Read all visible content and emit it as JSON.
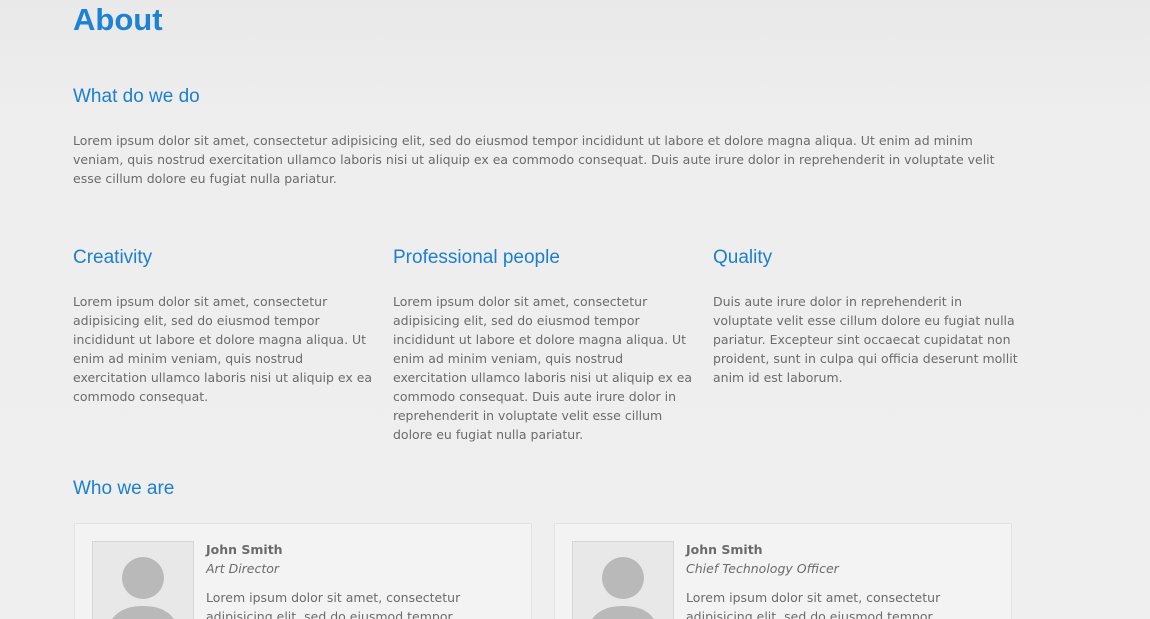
{
  "page": {
    "title": "About"
  },
  "what_we_do": {
    "heading": "What do we do",
    "text": "Lorem ipsum dolor sit amet, consectetur adipisicing elit, sed do eiusmod tempor incididunt ut labore et dolore magna aliqua. Ut enim ad minim veniam, quis nostrud exercitation ullamco laboris nisi ut aliquip ex ea commodo consequat. Duis aute irure dolor in reprehenderit in voluptate velit esse cillum dolore eu fugiat nulla pariatur."
  },
  "features": [
    {
      "heading": "Creativity",
      "text": "Lorem ipsum dolor sit amet, consectetur adipisicing elit, sed do eiusmod tempor incididunt ut labore et dolore magna aliqua. Ut enim ad minim veniam, quis nostrud exercitation ullamco laboris nisi ut aliquip ex ea commodo consequat."
    },
    {
      "heading": "Professional people",
      "text": "Lorem ipsum dolor sit amet, consectetur adipisicing elit, sed do eiusmod tempor incididunt ut labore et dolore magna aliqua. Ut enim ad minim veniam, quis nostrud exercitation ullamco laboris nisi ut aliquip ex ea commodo consequat. Duis aute irure dolor in reprehenderit in voluptate velit esse cillum dolore eu fugiat nulla pariatur."
    },
    {
      "heading": "Quality",
      "text": "Duis aute irure dolor in reprehenderit in voluptate velit esse cillum dolore eu fugiat nulla pariatur. Excepteur sint occaecat cupidatat non proident, sunt in culpa qui officia deserunt mollit anim id est laborum."
    }
  ],
  "who_we_are": {
    "heading": "Who we are",
    "members": [
      {
        "name": "John Smith",
        "role": "Art Director",
        "bio": "Lorem ipsum dolor sit amet, consectetur adipisicing elit, sed do eiusmod tempor",
        "avatar_icon": "user-silhouette-icon"
      },
      {
        "name": "John Smith",
        "role": "Chief Technology Officer",
        "bio": "Lorem ipsum dolor sit amet, consectetur adipisicing elit, sed do eiusmod tempor",
        "avatar_icon": "user-silhouette-icon"
      }
    ]
  },
  "colors": {
    "accent": "#1c83d4",
    "text": "#6b6b6b",
    "background": "#eeeeee"
  }
}
